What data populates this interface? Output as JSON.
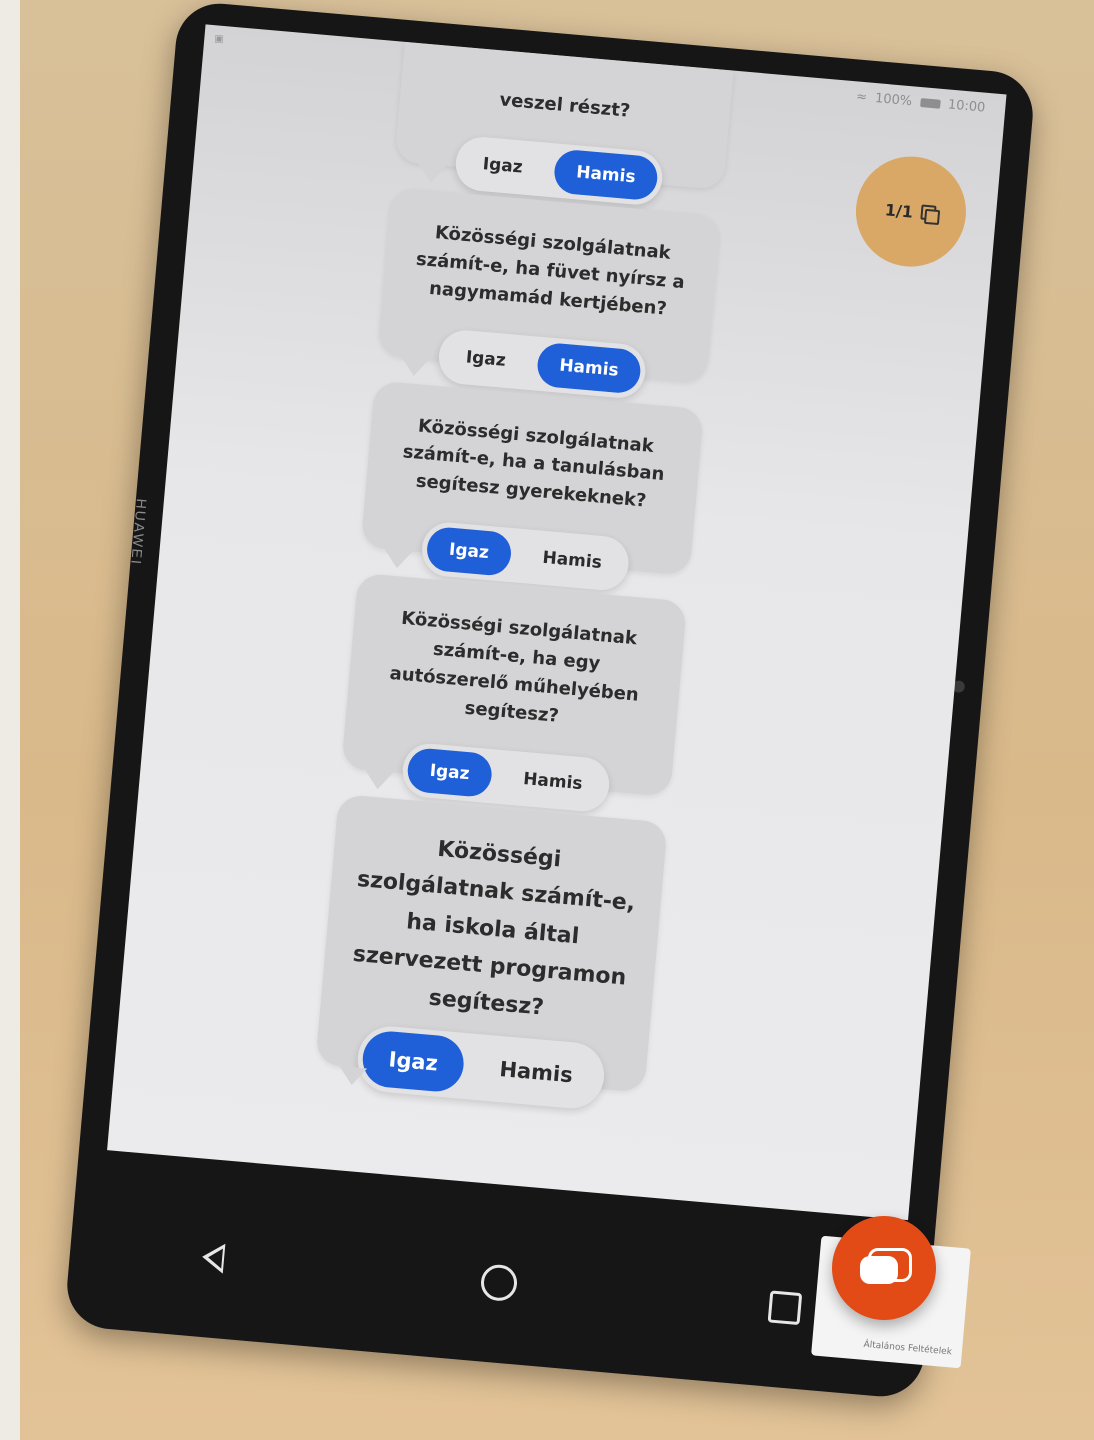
{
  "status_bar": {
    "wifi_battery": "100%",
    "time": "10:00"
  },
  "counter_badge": {
    "text": "1/1"
  },
  "quiz": {
    "cards": [
      {
        "question": "veszel részt?",
        "options": [
          "Igaz",
          "Hamis"
        ],
        "selected": "Hamis"
      },
      {
        "question": "Közösségi szolgálatnak számít-e, ha füvet nyírsz a nagymamád kertjében?",
        "options": [
          "Igaz",
          "Hamis"
        ],
        "selected": "Hamis"
      },
      {
        "question": "Közösségi szolgálatnak számít-e, ha a tanulásban segítesz gyerekeknek?",
        "options": [
          "Igaz",
          "Hamis"
        ],
        "selected": "Igaz"
      },
      {
        "question": "Közösségi szolgálatnak számít-e, ha egy autószerelő műhelyében segítesz?",
        "options": [
          "Igaz",
          "Hamis"
        ],
        "selected": "Igaz"
      },
      {
        "question": "Közösségi szolgálatnak számít-e, ha iskola által szervezett programon segítesz?",
        "options": [
          "Igaz",
          "Hamis"
        ],
        "selected": "Igaz"
      }
    ]
  },
  "device": {
    "brand": "HUAWEI"
  },
  "legal": {
    "text": "Általános Feltételek"
  },
  "colors": {
    "selected_pill": "#1f5fd8",
    "counter_badge": "#d9a866",
    "chat_fab": "#e24b15"
  },
  "icons": {
    "counter": "copy-icon",
    "chat": "chat-icon",
    "nav_back": "back-triangle-icon",
    "nav_home": "home-circle-icon",
    "nav_recent": "recent-square-icon"
  }
}
